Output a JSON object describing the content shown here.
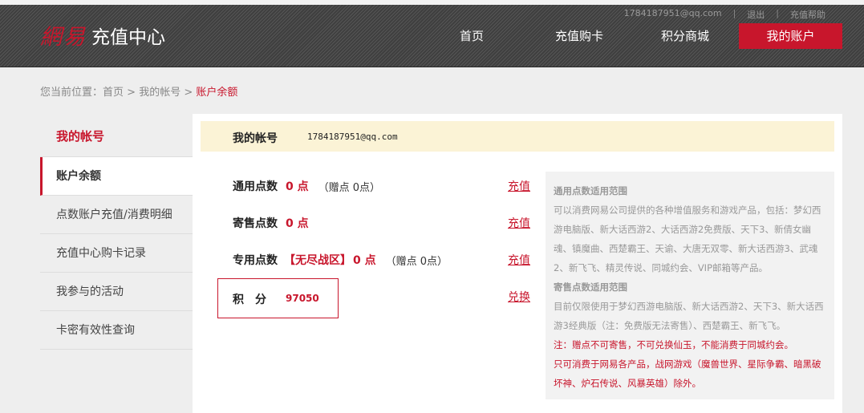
{
  "header": {
    "logo_mark": "網易",
    "logo_text": "充值中心",
    "user_email": "1784187951@qq.com",
    "logout": "退出",
    "help": "充值帮助",
    "separator": "|",
    "nav": [
      {
        "label": "首页"
      },
      {
        "label": "充值购卡"
      },
      {
        "label": "积分商城"
      },
      {
        "label": "我的账户"
      }
    ]
  },
  "breadcrumb": {
    "prefix": "您当前位置：",
    "home": "首页",
    "sep1": " > ",
    "account": "我的帐号",
    "sep2": " > ",
    "current": "账户余额"
  },
  "sidebar": {
    "title": "我的帐号",
    "items": [
      {
        "label": "账户余额"
      },
      {
        "label": "点数账户充值/消费明细"
      },
      {
        "label": "充值中心购卡记录"
      },
      {
        "label": "我参与的活动"
      },
      {
        "label": "卡密有效性查询"
      }
    ]
  },
  "account": {
    "label": "我的帐号",
    "value": "1784187951@qq.com"
  },
  "balances": {
    "general": {
      "label": "通用点数",
      "value": "0 点",
      "bonus": "（赠点 0点）",
      "action": "充值"
    },
    "consign": {
      "label": "寄售点数",
      "value": "0 点",
      "action": "充值"
    },
    "dedicated": {
      "label": "专用点数",
      "zone": "【无尽战区】",
      "value": "0 点",
      "bonus": "（赠点 0点）",
      "action": "充值"
    },
    "points": {
      "label": "积　分",
      "value": "97050",
      "action": "兑换"
    }
  },
  "info": {
    "general_title": "通用点数适用范围",
    "general_text": "可以消费网易公司提供的各种增值服务和游戏产品，包括：梦幻西游电脑版、新大话西游2、大话西游2免费版、天下3、新倩女幽魂、镇魔曲、西楚霸王、天谕、大唐无双零、新大话西游3、武魂2、新飞飞、精灵传说、同城约会、VIP邮箱等产品。",
    "consign_title": "寄售点数适用范围",
    "consign_text": "目前仅限使用于梦幻西游电脑版、新大话西游2、天下3、新大话西游3经典版（注：免费版无法寄售）、西楚霸王、新飞飞。",
    "note1": "注：赠点不可寄售，不可兑换仙玉，不能消费于同城约会。",
    "note2": "只可消费于网易各产品，战网游戏（魔兽世界、星际争霸、暗黑破坏神、炉石传说、风暴英雄）除外。"
  }
}
